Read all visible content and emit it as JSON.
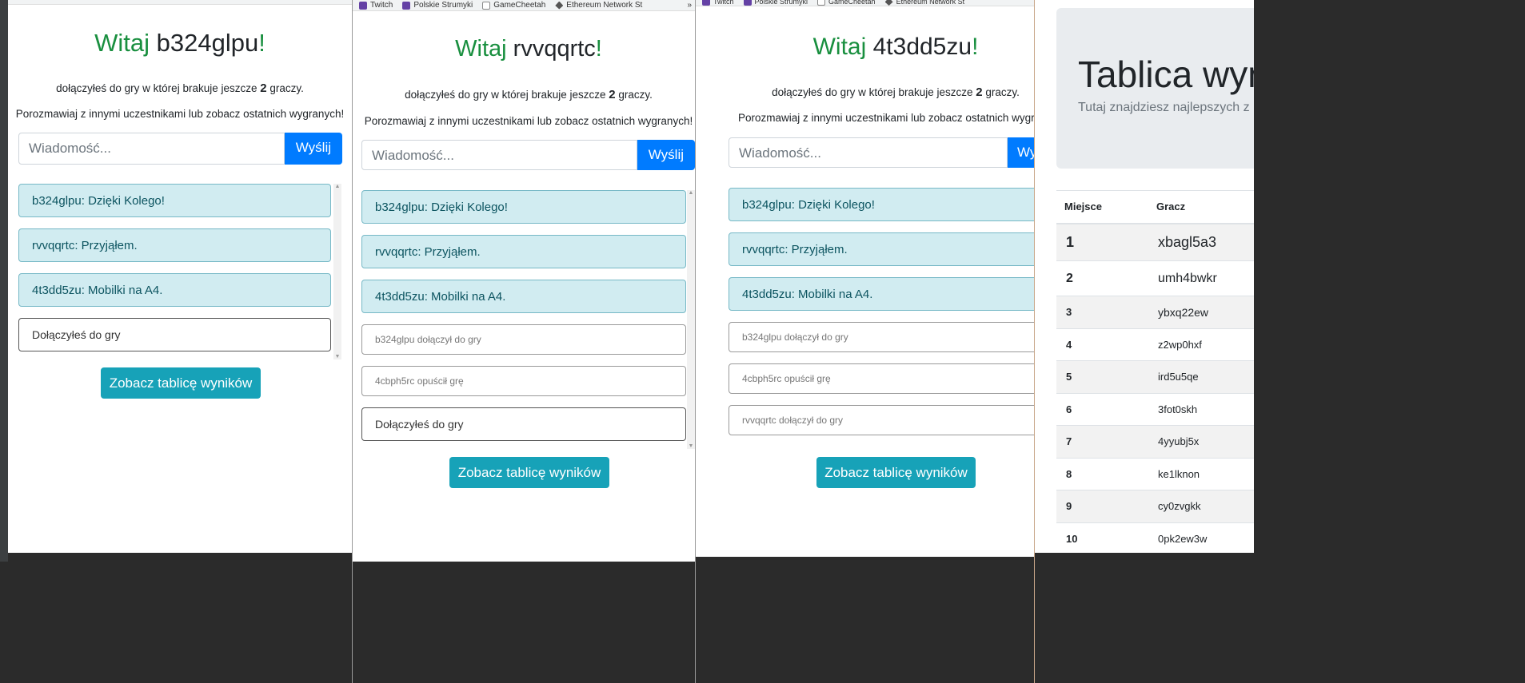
{
  "colors": {
    "green": "#198f3f",
    "primary": "#007bff",
    "info": "#17a2b8",
    "alert_bg": "#d1ecf1"
  },
  "bookmarks": [
    {
      "label": "Twitch",
      "icon": "twitch-icon"
    },
    {
      "label": "Polskie Strumyki",
      "icon": "twitch-icon"
    },
    {
      "label": "GameCheetah",
      "icon": "document-icon"
    },
    {
      "label": "Ethereum Network St",
      "icon": "ethereum-icon"
    }
  ],
  "bookmarks_overflow": "»",
  "common": {
    "greet_word": "Witaj",
    "exclaim": "!",
    "info_before": "dołączyłeś do gry w której brakuje jeszcze",
    "missing_count": "2",
    "info_after": "graczy.",
    "chat_hint": "Porozmawiaj z innymi uczestnikami lub zobacz ostatnich wygranych!",
    "input_placeholder": "Wiadomość...",
    "send_label": "Wyślij",
    "scoreboard_button": "Zobacz tablicę wyników"
  },
  "window1": {
    "username": "b324glpu",
    "messages": [
      "b324glpu: Dzięki Kolego!",
      "rvvqqrtc: Przyjąłem.",
      "4t3dd5zu: Mobilki na A4.",
      "Dołączyłeś do gry"
    ]
  },
  "window2": {
    "username": "rvvqqrtc",
    "messages": [
      "b324glpu: Dzięki Kolego!",
      "rvvqqrtc: Przyjąłem.",
      "4t3dd5zu: Mobilki na A4.",
      "b324glpu dołączył do gry",
      "4cbph5rc opuścił grę",
      "Dołączyłeś do gry"
    ]
  },
  "window3": {
    "username": "4t3dd5zu",
    "chat_hint": "Porozmawiaj z innymi uczestnikami lub zobacz ostatnich wygran",
    "send_label": "Wy",
    "messages": [
      "b324glpu: Dzięki Kolego!",
      "rvvqqrtc: Przyjąłem.",
      "4t3dd5zu: Mobilki na A4.",
      "b324glpu dołączył do gry",
      "4cbph5rc opuścił grę",
      "rvvqqrtc dołączył do gry"
    ]
  },
  "scoreboard": {
    "title": "Tablica wyni",
    "subtitle": "Tutaj znajdziesz najlepszych z na",
    "columns": [
      "Miejsce",
      "Gracz"
    ],
    "rows": [
      {
        "place": "1",
        "player": "xbagl5a3"
      },
      {
        "place": "2",
        "player": "umh4bwkr"
      },
      {
        "place": "3",
        "player": "ybxq22ew"
      },
      {
        "place": "4",
        "player": "z2wp0hxf"
      },
      {
        "place": "5",
        "player": "ird5u5qe"
      },
      {
        "place": "6",
        "player": "3fot0skh"
      },
      {
        "place": "7",
        "player": "4yyubj5x"
      },
      {
        "place": "8",
        "player": "ke1lknon"
      },
      {
        "place": "9",
        "player": "cy0zvgkk"
      },
      {
        "place": "10",
        "player": "0pk2ew3w"
      }
    ]
  }
}
